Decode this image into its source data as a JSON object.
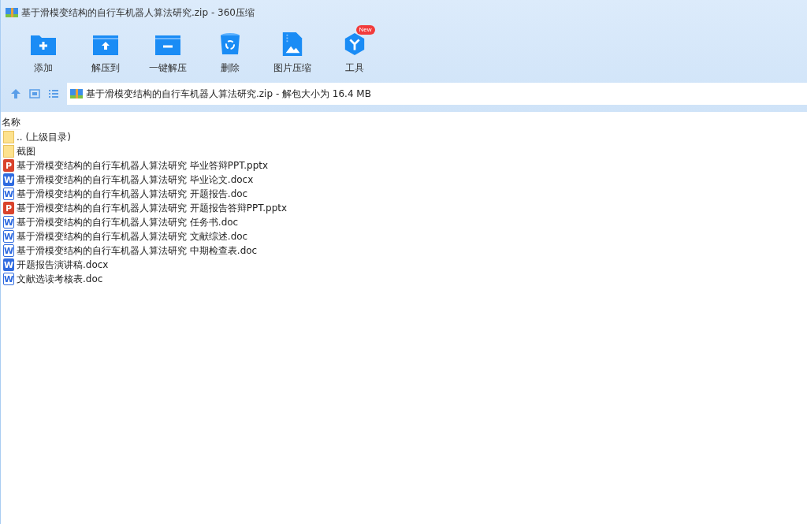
{
  "window": {
    "title": "基于滑模变结构的自行车机器人算法研究.zip - 360压缩"
  },
  "toolbar": [
    {
      "label": "添加",
      "kind": "add"
    },
    {
      "label": "解压到",
      "kind": "extract"
    },
    {
      "label": "一键解压",
      "kind": "oneclick"
    },
    {
      "label": "删除",
      "kind": "delete"
    },
    {
      "label": "图片压缩",
      "kind": "image"
    },
    {
      "label": "工具",
      "kind": "tools",
      "badge": "New"
    }
  ],
  "address": {
    "value": "基于滑模变结构的自行车机器人算法研究.zip - 解包大小为 16.4 MB"
  },
  "list": {
    "column": "名称",
    "rows": [
      {
        "name": ".. (上级目录)",
        "kind": "folder"
      },
      {
        "name": "截图",
        "kind": "folder"
      },
      {
        "name": "基于滑模变结构的自行车机器人算法研究 毕业答辩PPT.pptx",
        "kind": "pptx",
        "icon_letter": "P"
      },
      {
        "name": "基于滑模变结构的自行车机器人算法研究 毕业论文.docx",
        "kind": "docx",
        "icon_letter": "W"
      },
      {
        "name": "基于滑模变结构的自行车机器人算法研究 开题报告.doc",
        "kind": "doc",
        "icon_letter": "W"
      },
      {
        "name": "基于滑模变结构的自行车机器人算法研究 开题报告答辩PPT.pptx",
        "kind": "pptx",
        "icon_letter": "P"
      },
      {
        "name": "基于滑模变结构的自行车机器人算法研究 任务书.doc",
        "kind": "doc",
        "icon_letter": "W"
      },
      {
        "name": "基于滑模变结构的自行车机器人算法研究 文献综述.doc",
        "kind": "doc",
        "icon_letter": "W"
      },
      {
        "name": "基于滑模变结构的自行车机器人算法研究 中期检查表.doc",
        "kind": "doc",
        "icon_letter": "W"
      },
      {
        "name": "开题报告演讲稿.docx",
        "kind": "docx",
        "icon_letter": "W"
      },
      {
        "name": "文献选读考核表.doc",
        "kind": "doc",
        "icon_letter": "W"
      }
    ]
  }
}
